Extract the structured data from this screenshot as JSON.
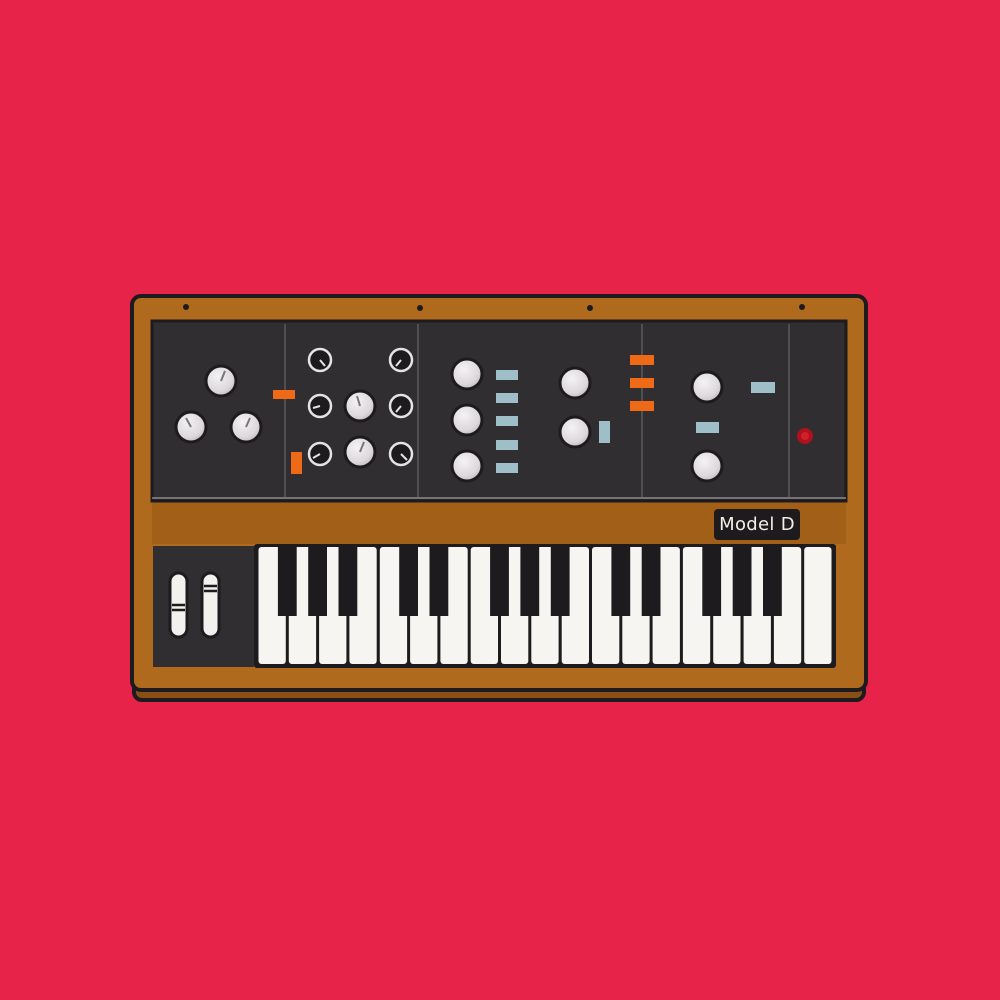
{
  "synth": {
    "model_label": "Model D"
  },
  "colors": {
    "background": "#e8234a",
    "wood": "#b06a1e",
    "wood_dark": "#8a4f14",
    "panel": "#302e31",
    "outline": "#1d1b1e",
    "knob": "#e6e3e6",
    "orange_switch": "#ef6a17",
    "blue_switch": "#9fbfc8",
    "red_light": "#b0101c",
    "white_key": "#f7f5f2",
    "black_key": "#1d1b1e"
  },
  "keyboard": {
    "white_key_count": 19
  },
  "icons": [
    "synthesizer-icon",
    "knob-icon",
    "switch-icon",
    "power-light-icon",
    "wheel-icon",
    "screw-icon"
  ]
}
